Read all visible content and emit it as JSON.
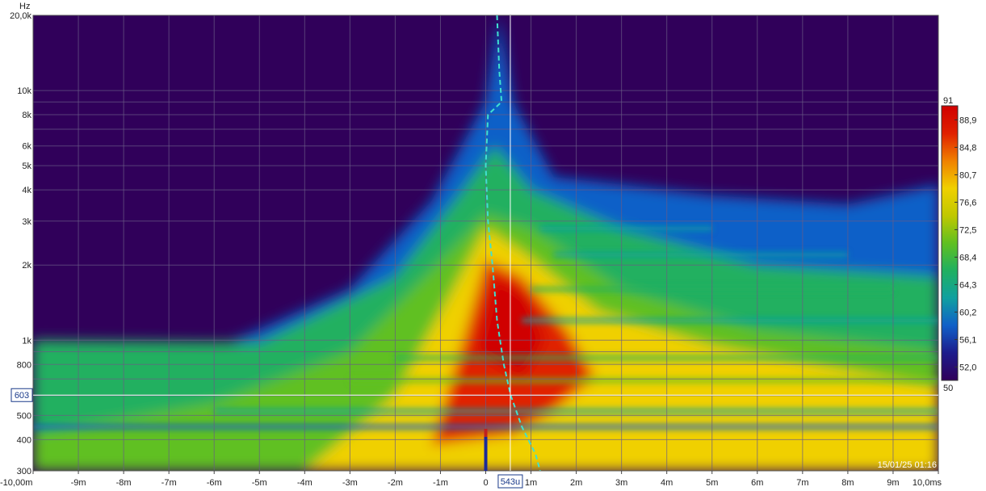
{
  "chart_data": {
    "type": "heatmap",
    "title": "",
    "ylabel": "Hz",
    "xlabel": "",
    "x_unit": "ms",
    "xlim": [
      -10.0,
      10.0
    ],
    "ylim": [
      300,
      20000
    ],
    "y_scale": "log",
    "grid": true,
    "x_ticks": [
      {
        "value": -10,
        "label": "-10,00m"
      },
      {
        "value": -9,
        "label": "-9m"
      },
      {
        "value": -8,
        "label": "-8m"
      },
      {
        "value": -7,
        "label": "-7m"
      },
      {
        "value": -6,
        "label": "-6m"
      },
      {
        "value": -5,
        "label": "-5m"
      },
      {
        "value": -4,
        "label": "-4m"
      },
      {
        "value": -3,
        "label": "-3m"
      },
      {
        "value": -2,
        "label": "-2m"
      },
      {
        "value": -1,
        "label": "-1m"
      },
      {
        "value": 0,
        "label": "0"
      },
      {
        "value": 1,
        "label": "1m"
      },
      {
        "value": 2,
        "label": "2m"
      },
      {
        "value": 3,
        "label": "3m"
      },
      {
        "value": 4,
        "label": "4m"
      },
      {
        "value": 5,
        "label": "5m"
      },
      {
        "value": 6,
        "label": "6m"
      },
      {
        "value": 7,
        "label": "7m"
      },
      {
        "value": 8,
        "label": "8m"
      },
      {
        "value": 9,
        "label": "9m"
      },
      {
        "value": 10,
        "label": "10,0ms"
      }
    ],
    "y_ticks": [
      {
        "value": 20000,
        "label": "20,0k"
      },
      {
        "value": 10000,
        "label": "10k"
      },
      {
        "value": 8000,
        "label": "8k"
      },
      {
        "value": 6000,
        "label": "6k"
      },
      {
        "value": 5000,
        "label": "5k"
      },
      {
        "value": 4000,
        "label": "4k"
      },
      {
        "value": 3000,
        "label": "3k"
      },
      {
        "value": 2000,
        "label": "2k"
      },
      {
        "value": 1000,
        "label": "1k"
      },
      {
        "value": 800,
        "label": "800"
      },
      {
        "value": 500,
        "label": "500"
      },
      {
        "value": 400,
        "label": "400"
      },
      {
        "value": 300,
        "label": "300"
      }
    ],
    "y_gridlines": [
      20000,
      10000,
      9000,
      8000,
      7000,
      6000,
      5000,
      4000,
      3000,
      2000,
      1000,
      900,
      800,
      700,
      600,
      500,
      400,
      300
    ],
    "colorbar": {
      "min": 50,
      "max": 91,
      "ticks": [
        {
          "value": 91,
          "label": "91"
        },
        {
          "value": 88.9,
          "label": "88,9"
        },
        {
          "value": 84.8,
          "label": "84,8"
        },
        {
          "value": 80.7,
          "label": "80,7"
        },
        {
          "value": 76.6,
          "label": "76,6"
        },
        {
          "value": 72.5,
          "label": "72,5"
        },
        {
          "value": 68.4,
          "label": "68,4"
        },
        {
          "value": 64.3,
          "label": "64,3"
        },
        {
          "value": 60.2,
          "label": "60,2"
        },
        {
          "value": 56.1,
          "label": "56,1"
        },
        {
          "value": 52.0,
          "label": "52,0"
        },
        {
          "value": 50,
          "label": "50"
        }
      ],
      "colors": [
        "#30005a",
        "#1c1c8c",
        "#1060c8",
        "#10a0a0",
        "#20b060",
        "#60c020",
        "#c0c800",
        "#f0d000",
        "#f08000",
        "#e02000",
        "#d00000"
      ]
    },
    "peak_delay_curve": [
      {
        "t": 0.25,
        "f": 20000
      },
      {
        "t": 0.3,
        "f": 12000
      },
      {
        "t": 0.35,
        "f": 9000
      },
      {
        "t": 0.05,
        "f": 8000
      },
      {
        "t": 0.0,
        "f": 5000
      },
      {
        "t": 0.05,
        "f": 3000
      },
      {
        "t": 0.15,
        "f": 2000
      },
      {
        "t": 0.25,
        "f": 1200
      },
      {
        "t": 0.4,
        "f": 800
      },
      {
        "t": 0.55,
        "f": 603
      },
      {
        "t": 0.8,
        "f": 450
      },
      {
        "t": 1.1,
        "f": 350
      },
      {
        "t": 1.2,
        "f": 300
      }
    ],
    "cursor": {
      "t": 0.543,
      "f": 603,
      "t_label": "543u",
      "f_label": "603"
    },
    "impulse_marker_t": 0.0,
    "timestamp": "15/01/25 01:16",
    "colors": {
      "background": "#30005a",
      "grid": "#6a5c86",
      "curve": "#40e0d0",
      "cursor": "#ffffff"
    }
  }
}
